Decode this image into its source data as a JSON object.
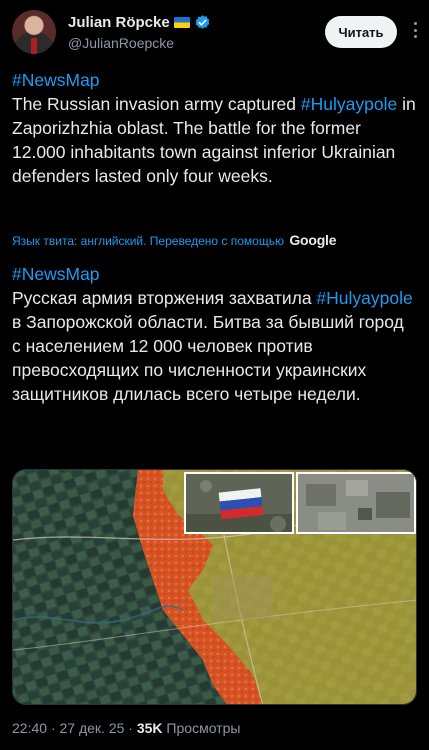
{
  "author": {
    "display_name": "Julian Röpcke",
    "handle": "@JulianRoepcke"
  },
  "header": {
    "read_button": "Читать"
  },
  "tweet_en": {
    "hashtag_map": "#NewsMap",
    "t1": "The Russian invasion army captured ",
    "hashtag_town": "#Hulyaypole",
    "t2": " in Zaporizhzhia oblast. The battle for the former 12.000 inhabitants town against inferior Ukrainian defenders lasted only four weeks."
  },
  "translation": {
    "note": "Язык твита: английский. Переведено с помощью",
    "provider": "Google"
  },
  "tweet_ru": {
    "hashtag_map": "#NewsMap",
    "t1": "Русская армия вторжения захватила ",
    "hashtag_town": "#Hulyaypole",
    "t2": " в Запорожской области. Битва за бывший город с населением 12 000 человек против превосходящих по численности украинских защитников длилась всего четыре недели."
  },
  "meta": {
    "time": "22:40",
    "sep1": " · ",
    "date": "27 дек. 25",
    "sep2": " · ",
    "views_count": "35K",
    "views_label": " Просмотры"
  },
  "colors": {
    "accent": "#1d9bf0",
    "russian_control": "#c9b33a",
    "advance_zone": "#e0451f",
    "background": "#000000"
  }
}
